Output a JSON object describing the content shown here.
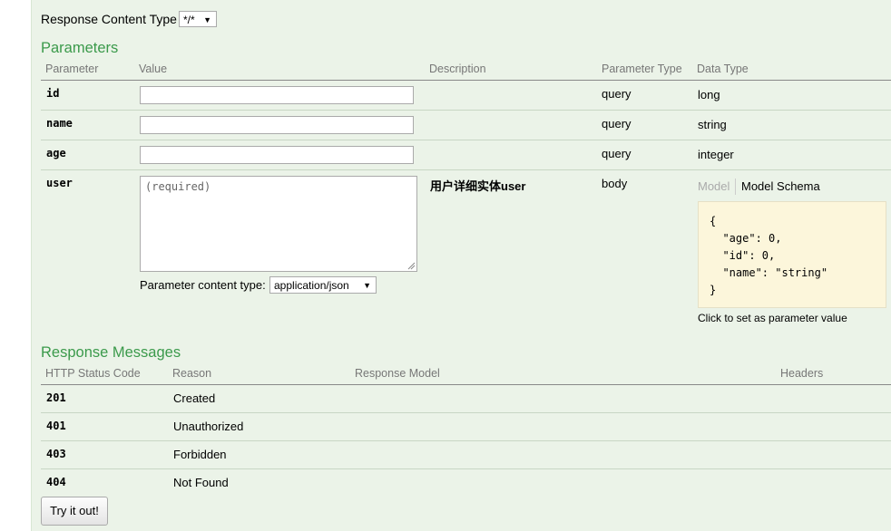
{
  "response_content_type": {
    "label": "Response Content Type",
    "value": "*/*"
  },
  "parameters": {
    "title": "Parameters",
    "headers": {
      "parameter": "Parameter",
      "value": "Value",
      "description": "Description",
      "param_type": "Parameter Type",
      "data_type": "Data Type"
    },
    "rows": [
      {
        "name": "id",
        "value": "",
        "description": "",
        "param_type": "query",
        "data_type": "long"
      },
      {
        "name": "name",
        "value": "",
        "description": "",
        "param_type": "query",
        "data_type": "string"
      },
      {
        "name": "age",
        "value": "",
        "description": "",
        "param_type": "query",
        "data_type": "integer"
      },
      {
        "name": "user",
        "placeholder": "(required)",
        "description": "用户详细实体user",
        "param_type": "body",
        "content_type_label": "Parameter content type:",
        "content_type_value": "application/json"
      }
    ],
    "model_tabs": {
      "model": "Model",
      "schema": "Model Schema"
    },
    "schema_lines": [
      "{",
      "  \"age\": 0,",
      "  \"id\": 0,",
      "  \"name\": \"string\"",
      "}"
    ],
    "schema_hint": "Click to set as parameter value"
  },
  "response_messages": {
    "title": "Response Messages",
    "headers": {
      "status": "HTTP Status Code",
      "reason": "Reason",
      "model": "Response Model",
      "headers": "Headers"
    },
    "rows": [
      {
        "code": "201",
        "reason": "Created"
      },
      {
        "code": "401",
        "reason": "Unauthorized"
      },
      {
        "code": "403",
        "reason": "Forbidden"
      },
      {
        "code": "404",
        "reason": "Not Found"
      }
    ]
  },
  "try_button": "Try it out!",
  "colors": {
    "panel_bg": "#ebf3e8",
    "section_title": "#3b9a4b",
    "schema_bg": "#fcf6db"
  }
}
